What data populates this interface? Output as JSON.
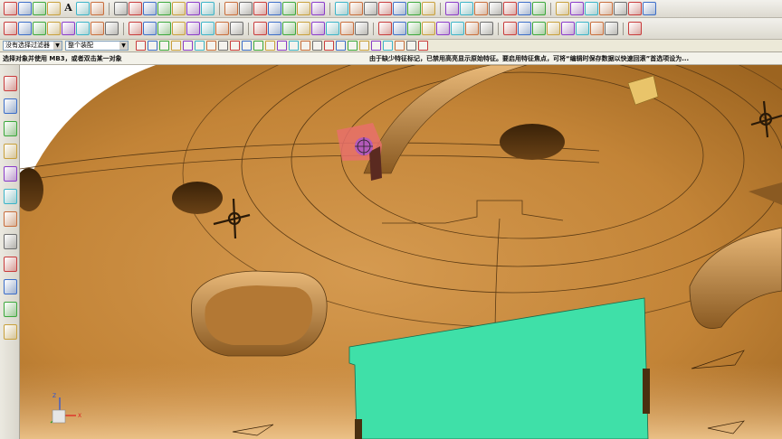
{
  "toolbar": {
    "row1_icons": [
      "line-tool-icon",
      "arc-tool-icon",
      "rectangle-tool-icon",
      "spline-tool-icon",
      "text-tool-icon",
      "sketch-icon",
      "fillet-icon",
      "offset-icon",
      "trim-icon",
      "extend-icon",
      "pattern-icon",
      "dimension-icon",
      "view-orient-icon",
      "sweep-icon",
      "loft-icon",
      "rib-icon",
      "shell-icon",
      "hole-icon",
      "draft-icon",
      "mirror-icon",
      "move-icon",
      "mold-icon",
      "measure-icon",
      "section-icon",
      "color-icon",
      "render-icon",
      "surface-icon",
      "blend-icon",
      "split-icon",
      "patch-icon",
      "trim-surface-icon",
      "knit-icon",
      "thicken-icon",
      "face-icon",
      "bridge-icon",
      "curve-icon",
      "wrap-icon",
      "analysis-icon",
      "draft-analysis-icon",
      "thickness-icon",
      "assembly-icon",
      "window-icon"
    ],
    "row1_text": "A",
    "row2_icons": [
      "sketch-plane-icon",
      "xy-plane-icon",
      "cube-icon",
      "feature-tree-icon",
      "solid-icon",
      "extrude-icon",
      "revolve-icon",
      "sweep-feature-icon",
      "cut-icon",
      "chamfer-icon",
      "wireframe-icon",
      "shaded-icon",
      "hidden-icon",
      "layer-icon",
      "capture-icon",
      "camera-icon",
      "save-view-icon",
      "print-icon",
      "zoom-icon",
      "pan-icon",
      "rotate-icon",
      "fit-icon",
      "front-view-icon",
      "top-view-icon",
      "right-view-icon",
      "iso-view-icon",
      "mold-base-icon",
      "core-icon",
      "cavity-icon",
      "parting-icon",
      "slider-icon",
      "lifter-icon",
      "ejector-icon",
      "cooling-icon",
      "gate-icon",
      "runner-icon",
      "bom-icon",
      "drawing-icon",
      "export-icon",
      "import-icon",
      "help-icon"
    ]
  },
  "selection_bar": {
    "filter_label": "没有选择过滤器",
    "scope_label": "整个装配",
    "icons": [
      "select-all-icon",
      "deselect-icon",
      "filter-icon",
      "snap-point-icon",
      "snap-end-icon",
      "snap-mid-icon",
      "snap-center-icon",
      "snap-quadrant-icon",
      "snap-intersect-icon",
      "snap-on-icon",
      "snap-face-icon",
      "snap-grid-icon",
      "box-select-icon",
      "lasso-icon",
      "view-icon",
      "feature-icon",
      "body-icon",
      "edge-icon",
      "vertex-icon",
      "line-icon",
      "circle-icon",
      "point-icon",
      "plus-icon",
      "slash-icon",
      "zoom-sel-icon"
    ]
  },
  "status": {
    "prompt": "选择对象并使用 MB3，或者双击某一对象",
    "message": "由于缺少特征标记，已禁用高亮显示原始特征。要启用特征焦点，可将“编辑时保存数据以快速回滚”首选项设为..."
  },
  "left_bar": {
    "icons": [
      "tools-icon",
      "feature-navigator-icon",
      "assembly-navigator-icon",
      "constraint-icon",
      "reuse-library-icon",
      "web-browser-icon",
      "history-icon",
      "system-materials-icon",
      "palette-icon",
      "roles-icon",
      "hd3d-icon",
      "information-icon"
    ]
  },
  "viewport": {
    "label": "3D model viewport",
    "axis_labels": {
      "x": "X",
      "y": "Y",
      "z": "Z"
    },
    "colors": {
      "part": "#c8873f",
      "insert": "#3fe0a8",
      "highlight": "#e8706a",
      "background": "#ffffff"
    }
  }
}
